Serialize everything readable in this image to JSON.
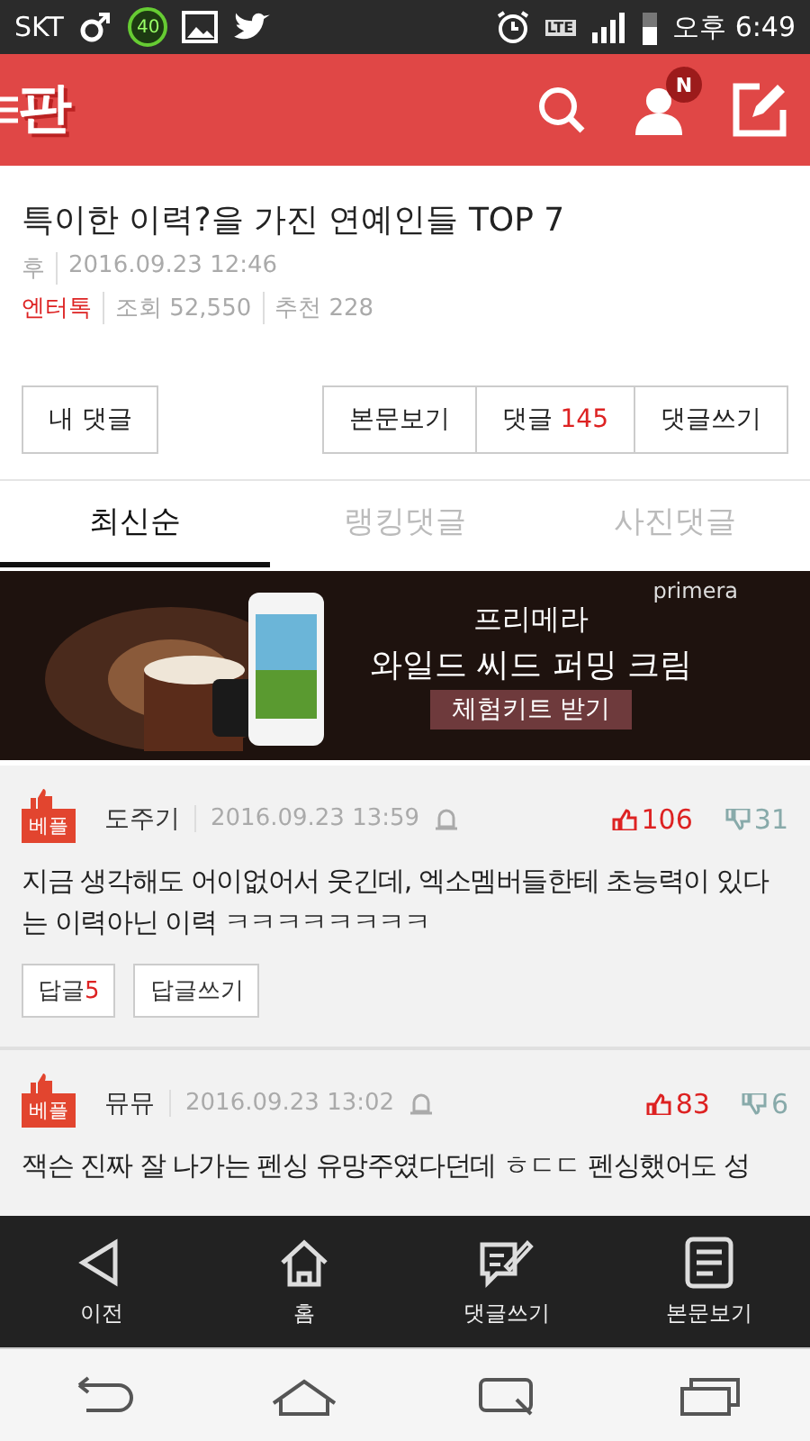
{
  "status_bar": {
    "carrier": "SKT",
    "badge": "40",
    "network": "LTE",
    "time": "오후 6:49"
  },
  "header": {
    "logo": "판",
    "notification_badge": "N"
  },
  "article": {
    "title": "특이한 이력?을 가진 연예인들 TOP 7",
    "author": "후",
    "date": "2016.09.23 12:46",
    "category": "엔터톡",
    "views": "조회 52,550",
    "recommends": "추천 228"
  },
  "my_comments_button": "내 댓글",
  "buttons": [
    {
      "label": "본문보기"
    },
    {
      "label": "댓글",
      "count": "145"
    },
    {
      "label": "댓글쓰기"
    }
  ],
  "tabs": [
    {
      "label": "최신순",
      "selected": true
    },
    {
      "label": "랭킹댓글",
      "selected": false
    },
    {
      "label": "사진댓글",
      "selected": false
    }
  ],
  "banner": {
    "brand": "primera",
    "line1": "프리메라",
    "line2": "와일드 씨드 퍼밍 크림",
    "cta": "체험키트 받기"
  },
  "comments": [
    {
      "badge": "베플",
      "author": "도주기",
      "date": "2016.09.23 13:59",
      "likes": "106",
      "dislikes": "31",
      "text": "지금 생각해도 어이없어서 웃긴데, 엑소멤버들한테 초능력이 있다는 이력아닌 이력 ㅋㅋㅋㅋㅋㅋㅋㅋ",
      "replies_label": "답글",
      "replies": "5",
      "reply_button": "답글쓰기"
    },
    {
      "badge": "베플",
      "author": "뮤뮤",
      "date": "2016.09.23 13:02",
      "likes": "83",
      "dislikes": "6",
      "text": "잭슨 진짜 잘 나가는 펜싱 유망주였다던데 ㅎㄷㄷ 펜싱했어도 성"
    }
  ],
  "bottom_bar": [
    {
      "kind": "back",
      "label": "이전"
    },
    {
      "kind": "home",
      "label": "홈"
    },
    {
      "kind": "write",
      "label": "댓글쓰기"
    },
    {
      "kind": "article",
      "label": "본문보기"
    }
  ]
}
